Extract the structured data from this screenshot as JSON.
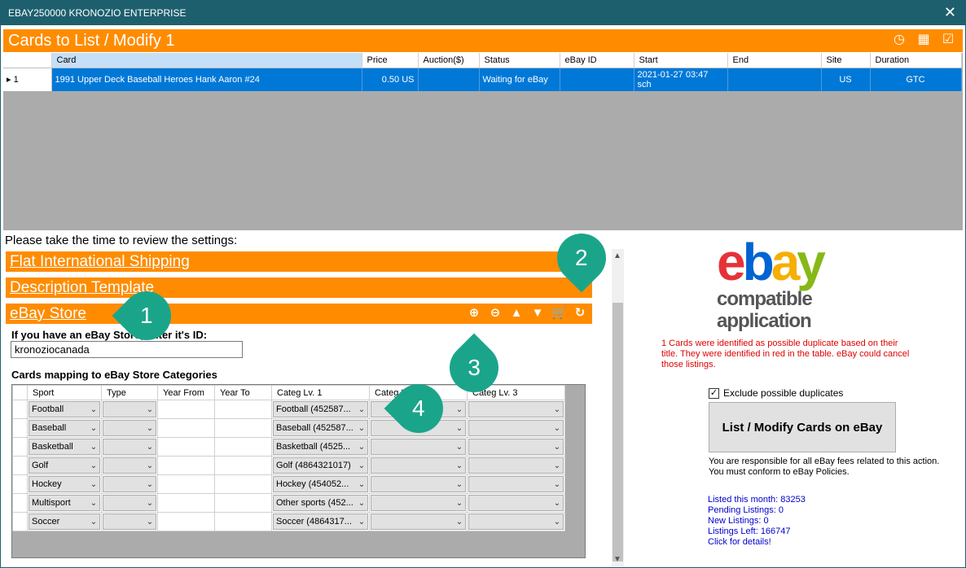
{
  "window": {
    "title": "EBAY250000 KRONOZIO ENTERPRISE"
  },
  "header": {
    "title": "Cards to List / Modify 1"
  },
  "cards_grid": {
    "columns": [
      "Card",
      "Price",
      "Auction($)",
      "Status",
      "eBay ID",
      "Start",
      "End",
      "Site",
      "Duration"
    ],
    "rows": [
      {
        "index": "1",
        "card": "1991 Upper Deck Baseball Heroes Hank Aaron #24",
        "price": "0.50 US",
        "auction": "",
        "status": "Waiting for eBay",
        "ebay_id": "",
        "start": "2021-01-27 03:47 sch",
        "end": "",
        "site": "US",
        "duration": "GTC"
      }
    ]
  },
  "settings": {
    "review_label": "Please take the time to review the settings:",
    "sections": {
      "shipping": "Flat International Shipping",
      "description": "Description Template",
      "store": "eBay Store"
    }
  },
  "store": {
    "id_label": "If you have an eBay Store, enter it's ID:",
    "id_value": "kronoziocanada",
    "mapping_label": "Cards mapping to eBay Store Categories",
    "columns": [
      "Sport",
      "Type",
      "Year From",
      "Year To",
      "Categ Lv. 1",
      "Categ Lv. 2",
      "Categ Lv. 3"
    ],
    "rows": [
      {
        "sport": "Football",
        "categ1": "Football (452587..."
      },
      {
        "sport": "Baseball",
        "categ1": "Baseball (452587..."
      },
      {
        "sport": "Basketball",
        "categ1": "Basketball (4525..."
      },
      {
        "sport": "Golf",
        "categ1": "Golf (4864321017)"
      },
      {
        "sport": "Hockey",
        "categ1": "Hockey (454052..."
      },
      {
        "sport": "Multisport",
        "categ1": "Other sports (452..."
      },
      {
        "sport": "Soccer",
        "categ1": "Soccer (4864317..."
      }
    ]
  },
  "right_panel": {
    "logo_word": "ebay",
    "logo_sub1": "compatible",
    "logo_sub2": "application",
    "duplicate_message": "1 Cards were identified as possible duplicate based on their title. They were identified in red in the table. eBay could cancel those listings.",
    "exclude_label": "Exclude possible duplicates",
    "list_button": "List / Modify Cards on eBay",
    "resp_line1": "You are responsible for all eBay fees related to this action.",
    "resp_line2": "You must conform to eBay Policies.",
    "stats": {
      "listed_month": "Listed this month: 83253",
      "pending": "Pending Listings: 0",
      "new": "New Listings: 0",
      "left": "Listings Left: 166747",
      "details": "Click for details!"
    }
  },
  "callouts": [
    "1",
    "2",
    "3",
    "4"
  ],
  "colors": {
    "accent": "#ff8c00",
    "titlebar": "#1e5f6e",
    "selection": "#0078d7",
    "callout": "#1aa58a"
  }
}
